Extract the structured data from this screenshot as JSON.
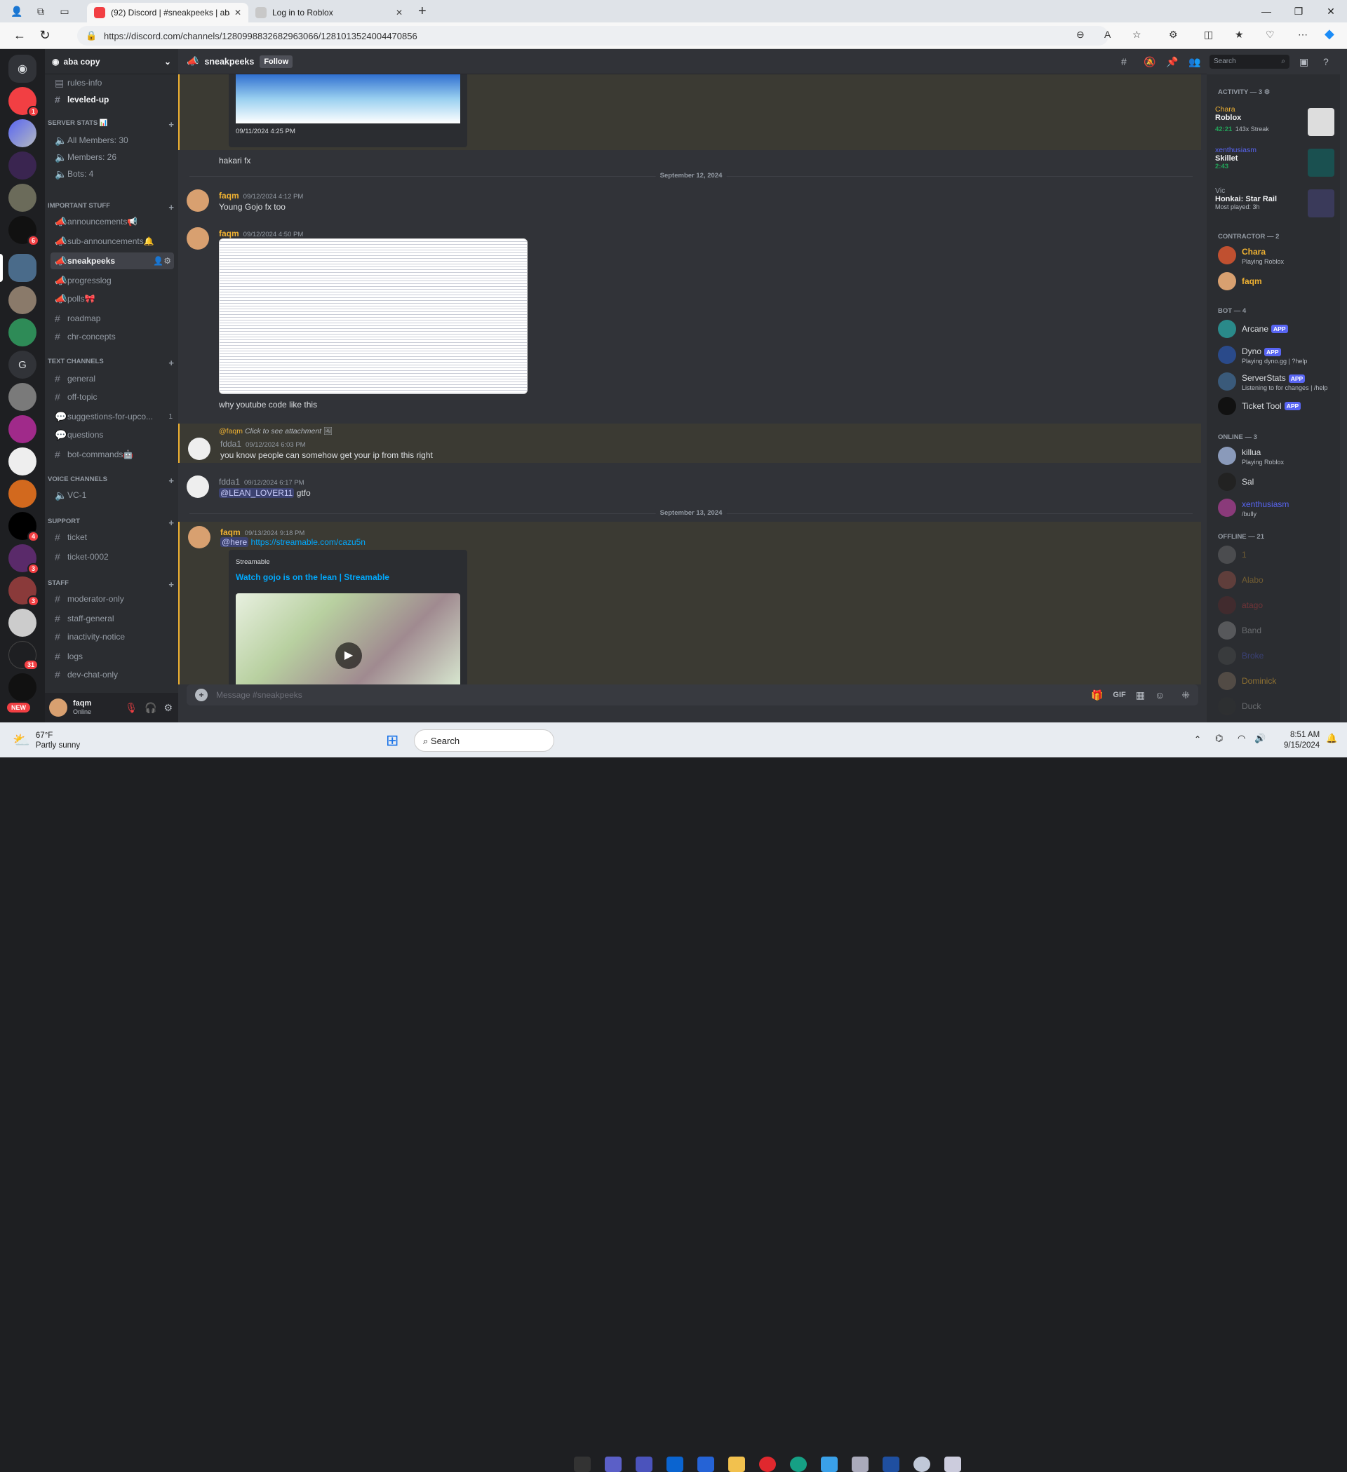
{
  "browser": {
    "tabs": [
      {
        "title": "(92) Discord | #sneakpeeks | aba",
        "active": true
      },
      {
        "title": "Log in to Roblox",
        "active": false
      }
    ],
    "url": "https://discord.com/channels/1280998832682963066/1281013524004470856"
  },
  "server": {
    "name": "aba copy",
    "guild_badges": [
      "1",
      "6",
      "4",
      "3",
      "3",
      "31"
    ],
    "guild_letter": "G",
    "new_label": "NEW"
  },
  "channels": {
    "top": [
      {
        "name": "rules-info"
      },
      {
        "name": "leveled-up"
      }
    ],
    "cat_server_stats": "SERVER STATS 📊",
    "server_stats": [
      "All Members: 30",
      "Members: 26",
      "Bots: 4"
    ],
    "cat_important": "IMPORTANT STUFF",
    "important": [
      "announcements📢",
      "sub-announcements🔔",
      "sneakpeeks",
      "progresslog",
      "polls🎀",
      "roadmap",
      "chr-concepts"
    ],
    "cat_text": "TEXT CHANNELS",
    "text": [
      "general",
      "off-topic",
      "suggestions-for-upco...",
      "questions",
      "bot-commands🤖"
    ],
    "suggestions_count": "1",
    "cat_voice": "VOICE CHANNELS",
    "voice": [
      "VC-1"
    ],
    "cat_support": "SUPPORT",
    "support": [
      "ticket",
      "ticket-0002"
    ],
    "cat_staff": "STAFF",
    "staff": [
      "moderator-only",
      "staff-general",
      "inactivity-notice",
      "logs",
      "dev-chat-only"
    ]
  },
  "user": {
    "name": "faqm",
    "status": "Online"
  },
  "header": {
    "channel": "sneakpeeks",
    "follow": "Follow",
    "search": "Search"
  },
  "chat": {
    "embed_timestamp": "09/11/2024 4:25 PM",
    "m0_text": "hakari fx",
    "date1": "September 12, 2024",
    "m1": {
      "author": "faqm",
      "time": "09/12/2024 4:12 PM",
      "text": "Young Gojo fx too"
    },
    "m2": {
      "author": "faqm",
      "time": "09/12/2024 4:50 PM",
      "text": "why youtube code like this"
    },
    "m3": {
      "reply_author": "@faqm",
      "reply_text": "Click to see attachment",
      "author": "fdda1",
      "time": "09/12/2024 6:03 PM",
      "text": "you know people can somehow get your ip from this right"
    },
    "m4": {
      "author": "fdda1",
      "time": "09/12/2024 6:17 PM",
      "mention": "@LEAN_LOVER11",
      "text": "gtfo"
    },
    "date2": "September 13, 2024",
    "m5": {
      "author": "faqm",
      "time": "09/13/2024 9:18 PM",
      "mention": "@here",
      "link": "https://streamable.com/cazu5n",
      "provider": "Streamable",
      "embed_title": "Watch gojo is on the lean | Streamable"
    },
    "composer_placeholder": "Message #sneakpeeks"
  },
  "members": {
    "activity_header": "ACTIVITY — 3",
    "activity": [
      {
        "user": "Chara",
        "game": "Roblox",
        "time": "42:21",
        "extra": "143x Streak"
      },
      {
        "user": "xenthusiasm",
        "game": "Skillet",
        "time": "2:43",
        "extra": ""
      },
      {
        "user": "Vic",
        "game": "Honkai: Star Rail",
        "time": "",
        "extra": "Most played: 3h"
      }
    ],
    "contractor_header": "CONTRACTOR — 2",
    "contractor": [
      {
        "name": "Chara",
        "sub": "Playing Roblox"
      },
      {
        "name": "faqm",
        "sub": ""
      }
    ],
    "bot_header": "BOT — 4",
    "app_tag": "APP",
    "bots": [
      {
        "name": "Arcane",
        "sub": ""
      },
      {
        "name": "Dyno",
        "sub": "Playing dyno.gg | ?help"
      },
      {
        "name": "ServerStats",
        "sub": "Listening to for changes | /help"
      },
      {
        "name": "Ticket Tool",
        "sub": ""
      }
    ],
    "online_header": "ONLINE — 3",
    "online": [
      {
        "name": "killua",
        "sub": "Playing Roblox"
      },
      {
        "name": "Sal",
        "sub": ""
      },
      {
        "name": "xenthusiasm",
        "sub": "/bully"
      }
    ],
    "offline_header": "OFFLINE — 21",
    "offline": [
      "1",
      "Alabo",
      "atago",
      "Band",
      "Broke",
      "Dominick",
      "Duck"
    ]
  },
  "taskbar": {
    "weather_temp": "67°F",
    "weather_desc": "Partly sunny",
    "search": "Search",
    "time": "8:51 AM",
    "date": "9/15/2024"
  },
  "colors": {
    "accent": "#5865f2",
    "online": "#23a55a",
    "mention_bg": "#3c4270",
    "link": "#00a8fc"
  }
}
